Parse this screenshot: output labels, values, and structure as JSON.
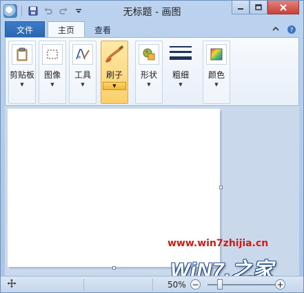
{
  "window": {
    "title": "无标题 - 画图"
  },
  "quick_access": {
    "icons": [
      "paint-app-icon",
      "save-icon",
      "undo-icon",
      "redo-icon",
      "customize-dropdown-icon"
    ]
  },
  "tabs": {
    "file": "文件",
    "home": "主页",
    "view": "查看"
  },
  "ribbon": {
    "clipboard": "剪贴板",
    "image": "图像",
    "tools": "工具",
    "brushes": "刷子",
    "shapes": "形状",
    "size": "粗细",
    "colors": "颜色"
  },
  "statusbar": {
    "zoom": "50%",
    "zoom_out": "−",
    "zoom_in": "+",
    "zoom_level": 0.5
  },
  "watermark": {
    "url": "www.win7zhijia.cn",
    "logo_text": "WiN7.之家"
  },
  "colors": {
    "file_tab": "#2a63ad",
    "selected_group": "#fccf6b",
    "close_button": "#c7403a",
    "watermark_url": "#d21a12"
  }
}
